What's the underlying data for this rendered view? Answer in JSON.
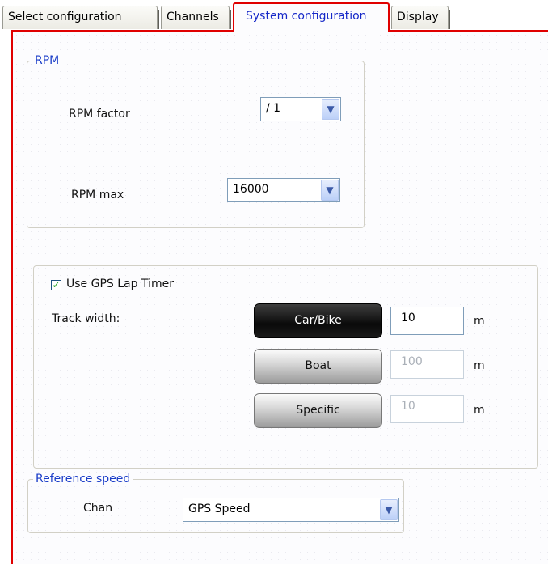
{
  "tabs": [
    {
      "label": "Select configuration",
      "selected": false
    },
    {
      "label": "Channels",
      "selected": false
    },
    {
      "label": "System configuration",
      "selected": true
    },
    {
      "label": "Display",
      "selected": false
    }
  ],
  "rpm": {
    "legend": "RPM",
    "factor_label": "RPM factor",
    "factor_value": "/ 1",
    "max_label": "RPM max",
    "max_value": "16000"
  },
  "gps": {
    "checkbox_label": "Use GPS Lap Timer",
    "checked": true,
    "track_width_label": "Track width:",
    "options": [
      {
        "label": "Car/Bike",
        "value": "10",
        "unit": "m",
        "selected": true
      },
      {
        "label": "Boat",
        "value": "100",
        "unit": "m",
        "selected": false
      },
      {
        "label": "Specific",
        "value": "10",
        "unit": "m",
        "selected": false
      }
    ]
  },
  "reference_speed": {
    "legend": "Reference speed",
    "chan_label": "Chan",
    "chan_value": "GPS Speed"
  },
  "icons": {
    "dropdown": "chevron-down-icon",
    "check": "checkmark-icon"
  },
  "colors": {
    "active_tab_border": "#e00000",
    "legend_text": "#1a3dc8",
    "active_tab_text": "#1628c8"
  }
}
